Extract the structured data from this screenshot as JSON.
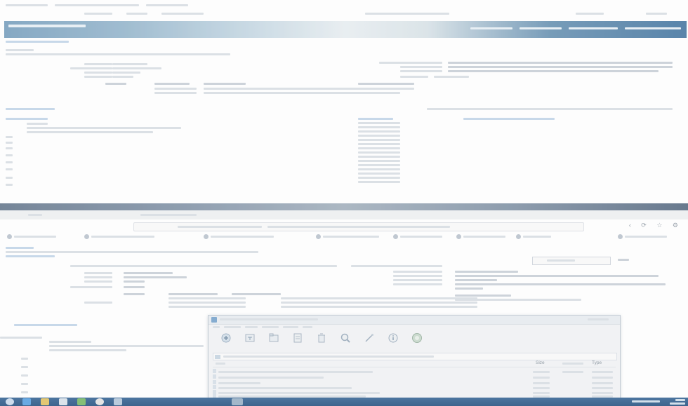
{
  "colors": {
    "banner_left": "#7fa6c4",
    "banner_right": "#4d7ea8",
    "taskbar": "#2e5a88",
    "dialog_bg": "#f7f9fb"
  },
  "browser": {
    "nav_controls": "‹ ⟳ ☆ ⚙"
  },
  "dialog": {
    "toolbar": [
      {
        "icon": "extract-icon"
      },
      {
        "icon": "folder-icon"
      },
      {
        "icon": "view-icon"
      },
      {
        "icon": "delete-icon"
      },
      {
        "icon": "find-icon"
      },
      {
        "icon": "wizard-icon"
      },
      {
        "icon": "info-icon"
      },
      {
        "icon": "virus-scan-icon"
      }
    ],
    "columns": {
      "size": "Size",
      "type": "Type"
    }
  },
  "taskbar": {
    "items": [
      {
        "icon": "start-icon"
      },
      {
        "icon": "ie-icon"
      },
      {
        "icon": "explorer-icon"
      },
      {
        "icon": "store-icon"
      },
      {
        "icon": "media-icon"
      },
      {
        "icon": "chrome-icon"
      },
      {
        "icon": "app-icon"
      }
    ]
  }
}
